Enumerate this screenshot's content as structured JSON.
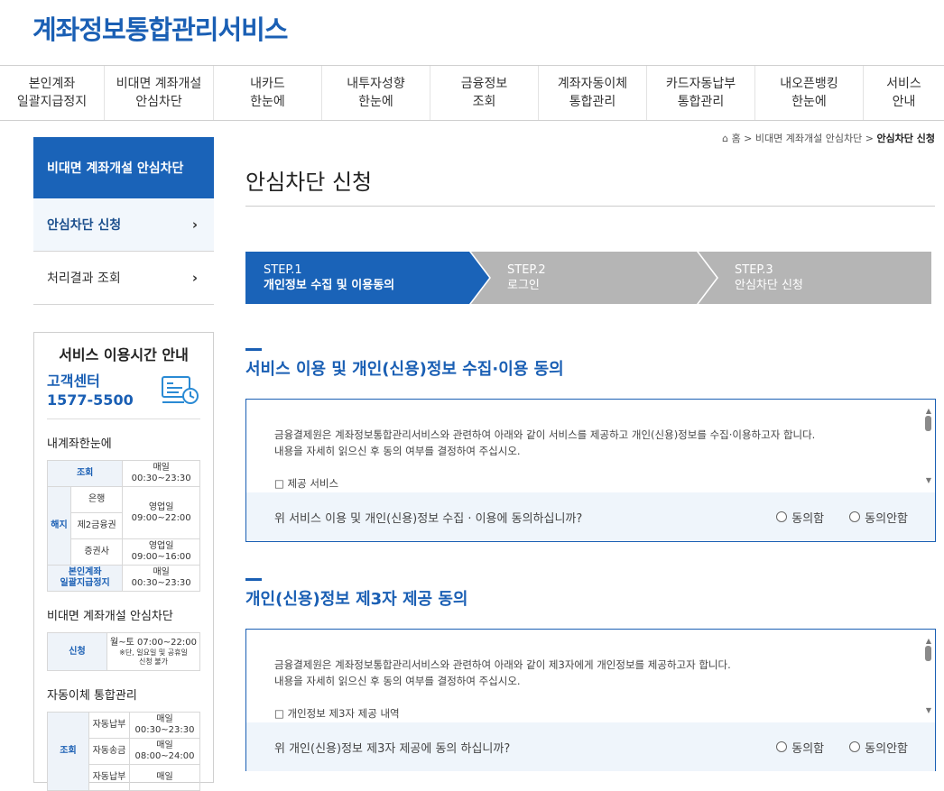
{
  "site": {
    "title": "계좌정보통합관리서비스"
  },
  "gnb": [
    "본인계좌\n일괄지급정지",
    "비대면 계좌개설\n안심차단",
    "내카드\n한눈에",
    "내투자성향\n한눈에",
    "금융정보\n조회",
    "계좌자동이체\n통합관리",
    "카드자동납부\n통합관리",
    "내오픈뱅킹\n한눈에",
    "서비스\n안내"
  ],
  "sidebar": {
    "title": "비대면 계좌개설 안심차단",
    "items": [
      {
        "label": "안심차단 신청"
      },
      {
        "label": "처리결과 조회"
      }
    ]
  },
  "info": {
    "title": "서비스 이용시간 안내",
    "cc_label": "고객센터",
    "cc_phone": "1577-5500",
    "sec1_title": "내계좌한눈에",
    "sec2_title": "비대면 계좌개설 안심차단",
    "sec3_title": "자동이체 통합관리",
    "t1": {
      "r1": {
        "h": "조회",
        "v": "매일\n00:30~23:30"
      },
      "r2": {
        "h": "해지",
        "s": "은행",
        "v": "영업일\n09:00~22:00"
      },
      "r3": {
        "s": "제2금융권"
      },
      "r4": {
        "s": "증권사",
        "v": "영업일\n09:00~16:00"
      },
      "r5": {
        "h": "본인계좌\n일괄지급정지",
        "v": "매일\n00:30~23:30"
      }
    },
    "t2": {
      "h": "신청",
      "v": "월~토 07:00~22:00",
      "note": "※단, 일요일 및 공휴일\n신청 불가"
    },
    "t3": {
      "h": "조회",
      "r1": {
        "s": "자동납부",
        "v": "매일\n00:30~23:30"
      },
      "r2": {
        "s": "자동송금",
        "v": "매일\n08:00~24:00"
      },
      "r3": {
        "s": "자동납부",
        "v": "매일"
      }
    }
  },
  "breadcrumb": {
    "home": "홈",
    "level1": "비대면 계좌개설 안심차단",
    "current": "안심차단 신청"
  },
  "page": {
    "title": "안심차단 신청"
  },
  "steps": [
    {
      "num": "STEP.1",
      "label": "개인정보 수집 및 이용동의",
      "active": true
    },
    {
      "num": "STEP.2",
      "label": "로그인",
      "active": false
    },
    {
      "num": "STEP.3",
      "label": "안심차단 신청",
      "active": false
    }
  ],
  "section1": {
    "title": "서비스 이용 및 개인(신용)정보 수집·이용 동의",
    "line1": "금융결제원은 계좌정보통합관리서비스와 관련하여 아래와 같이 서비스를 제공하고 개인(신용)정보를 수집·이용하고자 합니다.",
    "line2": "내용을 자세히 읽으신 후 동의 여부를 결정하여 주십시오.",
    "line3": "□ 제공 서비스",
    "question": "위 서비스 이용 및 개인(신용)정보 수집 · 이용에 동의하십니까?",
    "agree": "동의함",
    "disagree": "동의안함"
  },
  "section2": {
    "title": "개인(신용)정보 제3자 제공 동의",
    "line1": "금융결제원은 계좌정보통합관리서비스와 관련하여 아래와 같이 제3자에게 개인정보를 제공하고자 합니다.",
    "line2": "내용을 자세히 읽으신 후 동의 여부를 결정하여 주십시오.",
    "line3": "□ 개인정보 제3자 제공 내역",
    "question": "위 개인(신용)정보 제3자 제공에 동의 하십니까?",
    "agree": "동의함",
    "disagree": "동의안함"
  },
  "colors": {
    "primary": "#1a5fb4",
    "step_inactive": "#b5b5b5"
  }
}
